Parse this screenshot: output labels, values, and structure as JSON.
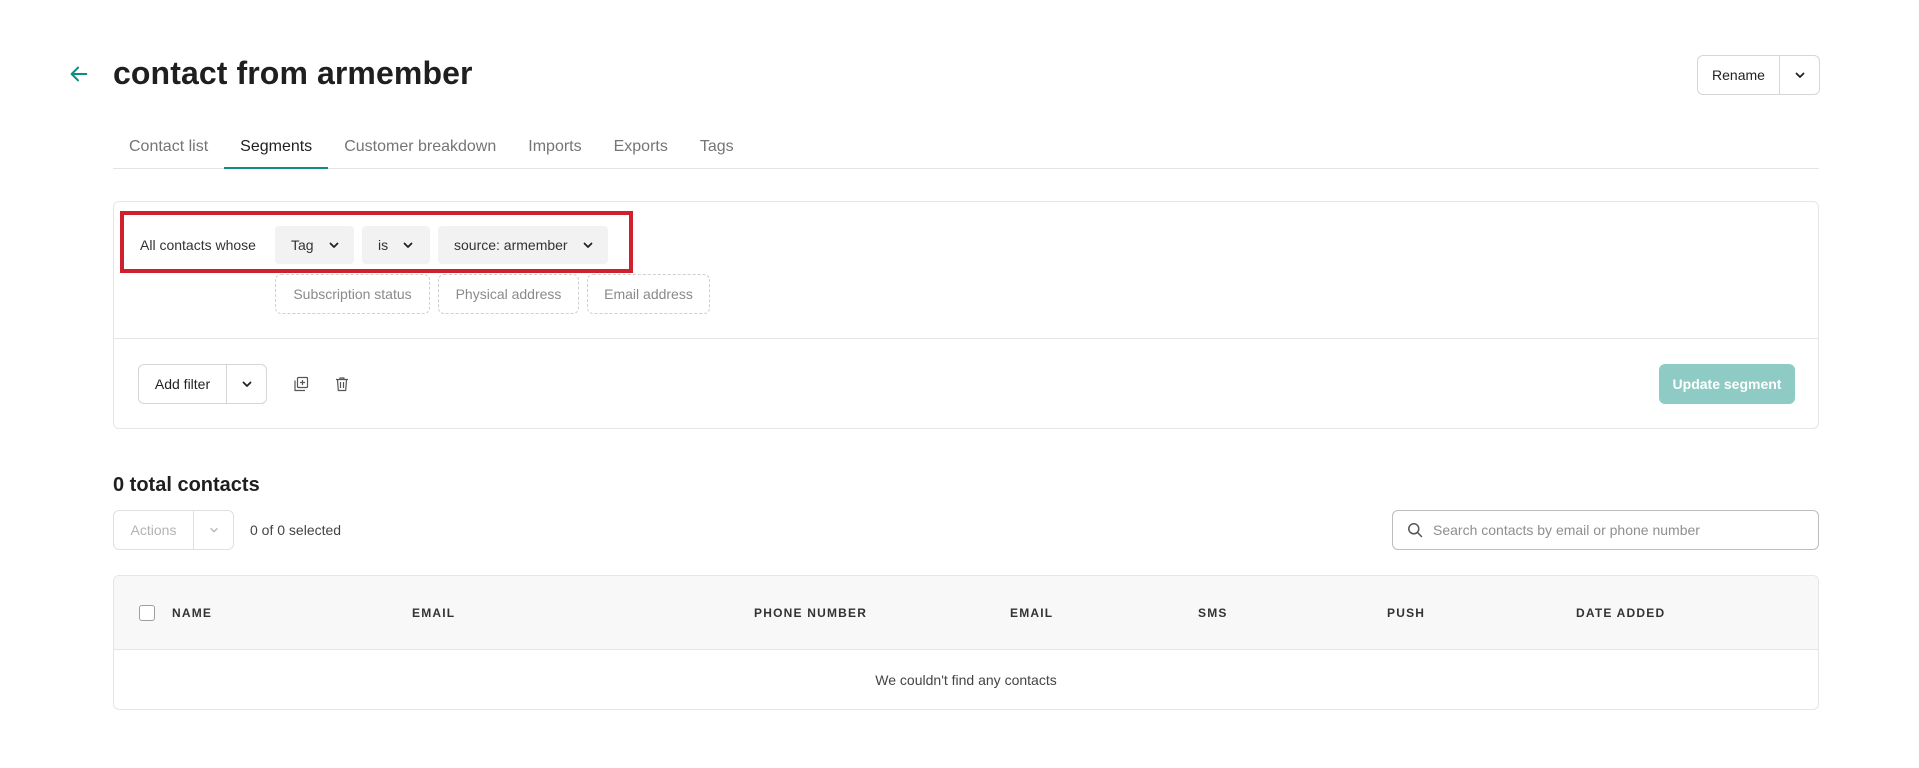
{
  "header": {
    "title": "contact from armember",
    "rename_label": "Rename"
  },
  "tabs": [
    {
      "label": "Contact list"
    },
    {
      "label": "Segments"
    },
    {
      "label": "Customer breakdown"
    },
    {
      "label": "Imports"
    },
    {
      "label": "Exports"
    },
    {
      "label": "Tags"
    }
  ],
  "active_tab": "Segments",
  "segment": {
    "prefix": "All contacts whose",
    "field": "Tag",
    "operator": "is",
    "value": "source: armember",
    "suggestions": [
      "Subscription status",
      "Physical address",
      "Email address"
    ],
    "add_filter_label": "Add filter",
    "update_label": "Update segment"
  },
  "contacts": {
    "total_label": "0 total contacts",
    "actions_label": "Actions",
    "selected_label": "0 of 0 selected",
    "search_placeholder": "Search contacts by email or phone number",
    "columns": [
      "NAME",
      "EMAIL",
      "PHONE NUMBER",
      "EMAIL",
      "SMS",
      "PUSH",
      "DATE ADDED"
    ],
    "empty_message": "We couldn't find any contacts"
  },
  "colors": {
    "accent": "#0d8c80",
    "update_button_disabled": "#8ecbc5",
    "highlight": "#d0202e"
  }
}
